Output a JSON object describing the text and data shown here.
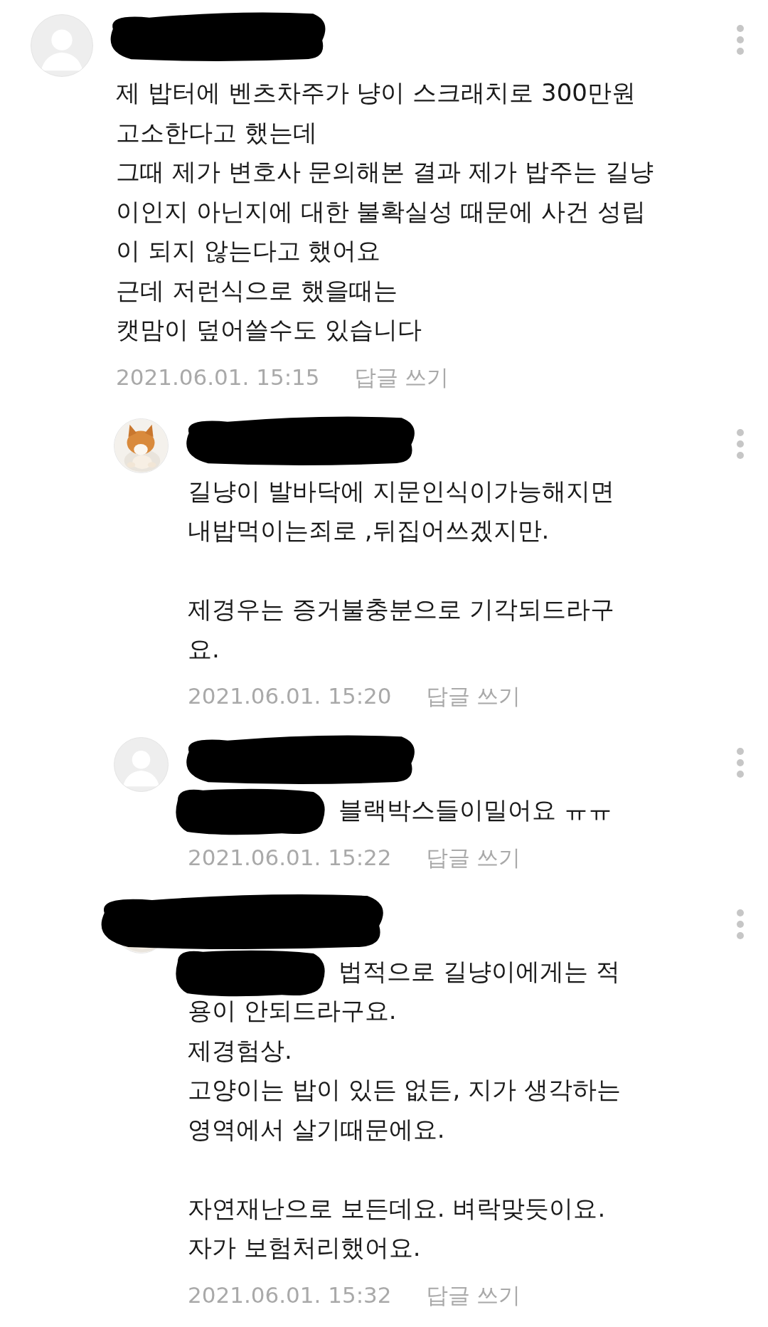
{
  "comments": [
    {
      "kind": "comment",
      "avatar": {
        "kind": "default"
      },
      "redacted_lead": false,
      "text": "제 밥터에 벤츠차주가 냥이 스크래치로 300만원\n고소한다고 했는데\n그때 제가 변호사 문의해본 결과 제가 밥주는 길냥\n이인지 아닌지에 대한 불확실성 때문에 사건 성립\n이 되지 않는다고 했어요\n근데 저런식으로 했을때는\n캣맘이 덮어쓸수도 있습니다",
      "date": "2021.06.01. 15:15",
      "reply_label": "답글 쓰기"
    },
    {
      "kind": "reply",
      "redacted_lead": false,
      "text": "길냥이 발바닥에 지문인식이가능해지면\n내밥먹이는죄로 ,뒤집어쓰겠지만.\n\n제경우는 증거불충분으로 기각되드라구\n요.",
      "date": "2021.06.01. 15:20",
      "reply_label": "답글 쓰기"
    },
    {
      "kind": "reply",
      "avatar": {
        "kind": "default"
      },
      "redacted_lead": true,
      "lead_text": "블랙박스들이밀어요 ㅠㅠ",
      "date": "2021.06.01. 15:22",
      "reply_label": "답글 쓰기"
    },
    {
      "kind": "reply",
      "redacted_lead": true,
      "lead_text": "법적으로 길냥이에게는 적",
      "text": "용이 안되드라구요.\n제경험상.\n고양이는 밥이 있든 없든, 지가 생각하는\n영역에서 살기때문에요.\n\n자연재난으로 보든데요. 벼락맞듯이요.\n자가 보험처리했어요.",
      "date": "2021.06.01. 15:32",
      "reply_label": "답글 쓰기"
    }
  ]
}
